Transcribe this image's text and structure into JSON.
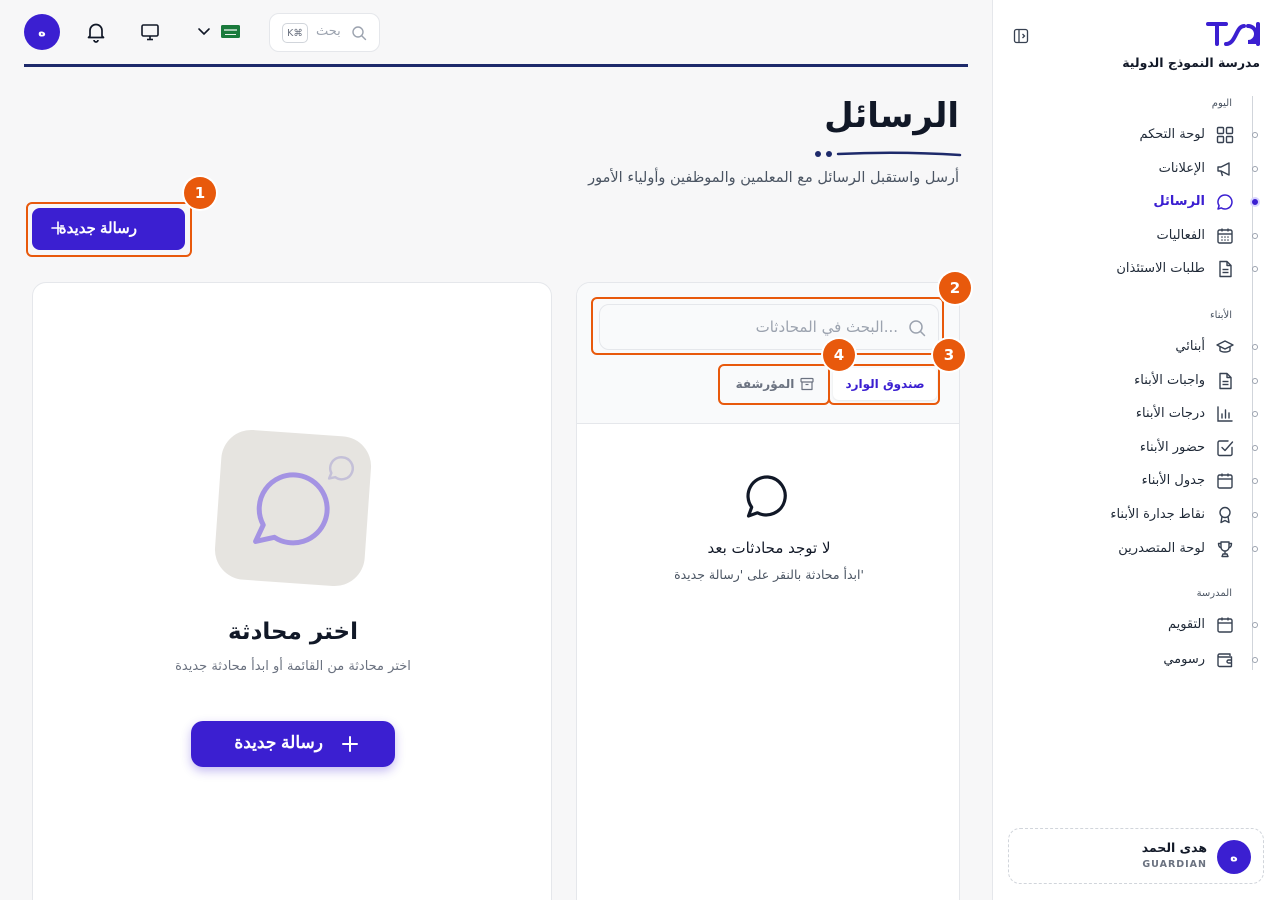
{
  "brand": {
    "name": "مدرسة النموذج الدولية"
  },
  "sidebar": {
    "sections": [
      {
        "label": "اليوم",
        "items": [
          {
            "label": "لوحة التحكم",
            "icon": "dashboard-icon",
            "active": false
          },
          {
            "label": "الإعلانات",
            "icon": "megaphone-icon",
            "active": false
          },
          {
            "label": "الرسائل",
            "icon": "message-circle-icon",
            "active": true
          },
          {
            "label": "الفعاليات",
            "icon": "calendar-grid-icon",
            "active": false
          },
          {
            "label": "طلبات الاستئذان",
            "icon": "file-text-icon",
            "active": false
          }
        ]
      },
      {
        "label": "الأبناء",
        "items": [
          {
            "label": "أبنائي",
            "icon": "graduation-cap-icon",
            "active": false
          },
          {
            "label": "واجبات الأبناء",
            "icon": "file-text-icon",
            "active": false
          },
          {
            "label": "درجات الأبناء",
            "icon": "bar-chart-icon",
            "active": false
          },
          {
            "label": "حضور الأبناء",
            "icon": "check-square-icon",
            "active": false
          },
          {
            "label": "جدول الأبناء",
            "icon": "calendar-icon",
            "active": false
          },
          {
            "label": "نقاط جدارة الأبناء",
            "icon": "award-icon",
            "active": false
          },
          {
            "label": "لوحة المتصدرين",
            "icon": "trophy-icon",
            "active": false
          }
        ]
      },
      {
        "label": "المدرسة",
        "items": [
          {
            "label": "التقويم",
            "icon": "calendar-icon",
            "active": false
          },
          {
            "label": "رسومي",
            "icon": "wallet-icon",
            "active": false
          }
        ]
      }
    ]
  },
  "user": {
    "initial": "ه",
    "name": "هدى الحمد",
    "role": "GUARDIAN"
  },
  "topbar": {
    "avatar_initial": "ه",
    "search_placeholder": "بحث",
    "shortcut": "K⌘",
    "language_flag": "saudi-flag-icon"
  },
  "page": {
    "title": "الرسائل",
    "subtitle": "أرسل واستقبل الرسائل مع المعلمين والموظفين وأولياء الأمور",
    "new_message_label": "رسالة جديدة"
  },
  "conversations": {
    "search_placeholder": "البحث في المحادثات...",
    "tabs": [
      {
        "label": "صندوق الوارد",
        "active": true
      },
      {
        "label": "المؤرشفة",
        "active": false
      }
    ],
    "empty_title": "لا توجد محادثات بعد",
    "empty_subtitle": "ابدأ محادثة بالنقر على 'رسالة جديدة'"
  },
  "detail": {
    "title": "اختر محادثة",
    "subtitle": "اختر محادثة من القائمة أو ابدأ محادثة جديدة",
    "button_label": "رسالة جديدة"
  },
  "annotations": [
    "1",
    "2",
    "3",
    "4"
  ],
  "colors": {
    "primary": "#3b1fd1",
    "annotation": "#e8590c",
    "navy": "#1e2a6b"
  }
}
